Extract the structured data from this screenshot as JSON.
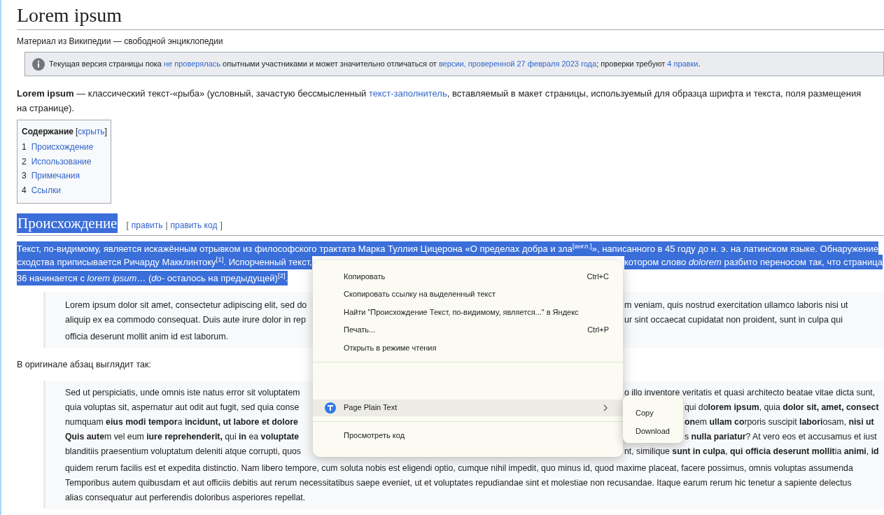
{
  "page_title": "Lorem ipsum",
  "tagline": "Материал из Википедии — свободной энциклопедии",
  "notice": {
    "segments": [
      {
        "text": "Текущая версия страницы пока ",
        "link": false
      },
      {
        "text": "не проверялась",
        "link": true
      },
      {
        "text": " опытными участниками и может значительно отличаться от ",
        "link": false
      },
      {
        "text": "версии, проверенной 27 февраля 2023 года",
        "link": true
      },
      {
        "text": "; проверки требуют ",
        "link": false
      },
      {
        "text": "4 правки",
        "link": true
      },
      {
        "text": ".",
        "link": false
      }
    ]
  },
  "intro": {
    "segments": [
      {
        "text": "**Lorem ipsum** — классический текст-«рыба» (условный, зачастую бессмысленный ",
        "link": false
      },
      {
        "text": "текст-заполнитель",
        "link": true
      },
      {
        "text": ", вставляемый в макет страницы, используемый для образца шрифта и текста, поля размещения на странице).",
        "link": false
      }
    ]
  },
  "toc": {
    "title": "Содержание",
    "open_bracket": "[",
    "toggle": "скрыть",
    "close_bracket": "]",
    "items": [
      {
        "number": "1",
        "label": "Происхождение"
      },
      {
        "number": "2",
        "label": "Использование"
      },
      {
        "number": "3",
        "label": "Примечания"
      },
      {
        "number": "4",
        "label": "Ссылки"
      }
    ]
  },
  "section": {
    "heading": "Происхождение",
    "selected": true,
    "edit": {
      "open_bracket": "[",
      "links": [
        "править",
        "править код"
      ],
      "separator": "|",
      "close_bracket": "]"
    },
    "lines": [
      {
        "text": "Текст, по-видимому, является искажённым отрывком из философского трактата Марка Туллия Цицерона «О пределах добра и зла$^{[англ.]}$», написанного в 45 году до н. э. на латинском языке. Обнаружение"
      },
      {
        "left": "сходства приписывается Ричарду Макклинтоку$^{[1]}$. Испорченный текст,",
        "right": "котором слово *dolorem* разбито переносом так, что страница",
        "kind": "split"
      },
      {
        "text": "36 начинается с *lorem ipsum*… (*do-* осталось на предыдущей)$^{[2]}$."
      }
    ]
  },
  "blockquote_1": {
    "lines": [
      {
        "left": "Lorem ipsum dolor sit amet, consectetur adipiscing elit, sed do",
        "right": "m veniam, quis nostrud exercitation ullamco laboris nisi ut",
        "kind": "split"
      },
      {
        "left": "aliquip ex ea commodo consequat. Duis aute irure dolor in rep",
        "right": "ur sint occaecat cupidatat non proident, sunt in culpa qui",
        "kind": "split"
      },
      {
        "text": "officia deserunt mollit anim id est laborum."
      }
    ]
  },
  "note": "В оригинале абзац выглядит так:",
  "blockquote_2": {
    "lines": [
      {
        "left": "Sed ut perspiciatis, unde omnis iste natus error sit voluptatem",
        "right": "o illo inventore veritatis et quasi architecto beatae vitae dicta sunt,",
        "kind": "split"
      },
      {
        "left": "quia voluptas sit, aspernatur aut odit aut fugit, sed quia conse",
        "right": "qui do**lorem ipsum**, quia **dolor sit, amet, consect**",
        "kind": "split_wide"
      },
      {
        "left": "numquam **eius modi** **tempor**a **incidunt, ut labore et dolore**",
        "right": "**on**em **ullam co**rporis suscipit **labori**osam, **nisi ut**",
        "kind": "split_wide"
      },
      {
        "left": "**Quis aute**m vel eum **iure reprehenderit,** qui **in** ea **voluptate**",
        "right": "s **nulla pariatur**? At vero eos et accusamus et iust",
        "kind": "split_wide"
      },
      {
        "left": "blanditiis praesentium voluptatum deleniti atque corrupti, quos",
        "right": "nt, similique **sunt in culpa**, **qui officia deserunt mollit**ia **animi**, **id**",
        "kind": "split"
      },
      {
        "text": "quidem rerum facilis est et expedita distinctio. Nam libero tempore, cum soluta nobis est eligendi optio, cumque nihil impedit, quo minus id, quod maxime placeat, facere possimus, omnis voluptas assumenda"
      },
      {
        "text": "Temporibus autem quibusdam et aut officiis debitis aut rerum necessitatibus saepe eveniet, ut et voluptates repudiandae sint et molestiae non recusandae. Itaque earum rerum hic tenetur a sapiente delectus"
      },
      {
        "text": "alias consequatur aut perferendis doloribus asperiores repellat."
      }
    ]
  },
  "context_menu": {
    "items": [
      {
        "kind": "item",
        "label": "Копировать",
        "shortcut": "Ctrl+C",
        "selected": false
      },
      {
        "kind": "item",
        "label": "Скопировать ссылку на выделенный текст",
        "selected": false
      },
      {
        "kind": "item",
        "label": "Найти \"Происхождение Текст, по-видимому, является...\" в Яндекс",
        "selected": false
      },
      {
        "kind": "item",
        "label": "Печать...",
        "shortcut": "Ctrl+P",
        "selected": false
      },
      {
        "kind": "item",
        "label": "Открыть в режиме чтения",
        "selected": false
      },
      {
        "kind": "divider"
      },
      {
        "kind": "blank"
      },
      {
        "kind": "submenu",
        "label": "Page Plain Text",
        "selected": true
      },
      {
        "kind": "divider"
      },
      {
        "kind": "item",
        "label": "Просмотреть код",
        "selected": false
      }
    ],
    "submenu": {
      "items": [
        {
          "label": "Copy"
        },
        {
          "label": "Download"
        }
      ]
    }
  }
}
